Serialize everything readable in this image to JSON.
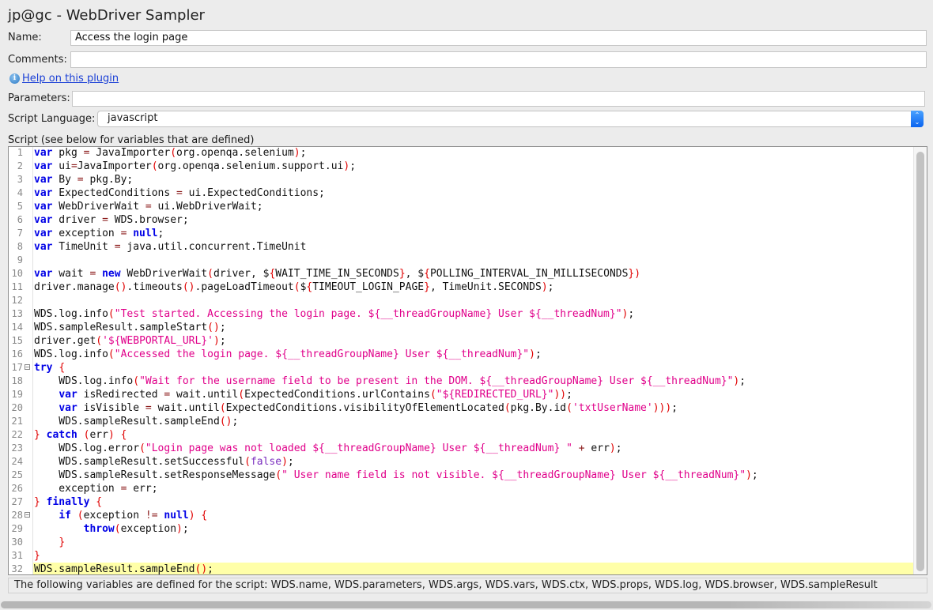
{
  "window": {
    "title": "jp@gc - WebDriver Sampler"
  },
  "form": {
    "name_label": "Name:",
    "name_value": "Access the login page",
    "comments_label": "Comments:",
    "comments_value": "",
    "help_link": "Help on this plugin",
    "parameters_label": "Parameters:",
    "parameters_value": "",
    "script_language_label": "Script Language:",
    "script_language_value": "javascript",
    "script_label": "Script (see below for variables that are defined)"
  },
  "editor": {
    "highlighted_line": 32,
    "fold_markers": [
      17,
      28
    ],
    "lines": [
      [
        [
          "kw",
          "var"
        ],
        [
          "id",
          " pkg "
        ],
        [
          "op",
          "="
        ],
        [
          "id",
          " JavaImporter"
        ],
        [
          "br",
          "("
        ],
        [
          "id",
          "org.openqa.selenium"
        ],
        [
          "br",
          ")"
        ],
        [
          "id",
          ";"
        ]
      ],
      [
        [
          "kw",
          "var"
        ],
        [
          "id",
          " ui"
        ],
        [
          "op",
          "="
        ],
        [
          "id",
          "JavaImporter"
        ],
        [
          "br",
          "("
        ],
        [
          "id",
          "org.openqa.selenium.support.ui"
        ],
        [
          "br",
          ")"
        ],
        [
          "id",
          ";"
        ]
      ],
      [
        [
          "kw",
          "var"
        ],
        [
          "id",
          " By "
        ],
        [
          "op",
          "="
        ],
        [
          "id",
          " pkg.By;"
        ]
      ],
      [
        [
          "kw",
          "var"
        ],
        [
          "id",
          " ExpectedConditions "
        ],
        [
          "op",
          "="
        ],
        [
          "id",
          " ui.ExpectedConditions;"
        ]
      ],
      [
        [
          "kw",
          "var"
        ],
        [
          "id",
          " WebDriverWait "
        ],
        [
          "op",
          "="
        ],
        [
          "id",
          " ui.WebDriverWait;"
        ]
      ],
      [
        [
          "kw",
          "var"
        ],
        [
          "id",
          " driver "
        ],
        [
          "op",
          "="
        ],
        [
          "id",
          " WDS.browser;"
        ]
      ],
      [
        [
          "kw",
          "var"
        ],
        [
          "id",
          " exception "
        ],
        [
          "op",
          "="
        ],
        [
          "id",
          " "
        ],
        [
          "kw",
          "null"
        ],
        [
          "id",
          ";"
        ]
      ],
      [
        [
          "kw",
          "var"
        ],
        [
          "id",
          " TimeUnit "
        ],
        [
          "op",
          "="
        ],
        [
          "id",
          " java.util.concurrent.TimeUnit"
        ]
      ],
      [],
      [
        [
          "kw",
          "var"
        ],
        [
          "id",
          " wait "
        ],
        [
          "op",
          "="
        ],
        [
          "id",
          " "
        ],
        [
          "kw",
          "new"
        ],
        [
          "id",
          " WebDriverWait"
        ],
        [
          "br",
          "("
        ],
        [
          "id",
          "driver, $"
        ],
        [
          "br",
          "{"
        ],
        [
          "id",
          "WAIT_TIME_IN_SECONDS"
        ],
        [
          "br",
          "}"
        ],
        [
          "id",
          ", $"
        ],
        [
          "br",
          "{"
        ],
        [
          "id",
          "POLLING_INTERVAL_IN_MILLISECONDS"
        ],
        [
          "br",
          "})"
        ]
      ],
      [
        [
          "id",
          "driver.manage"
        ],
        [
          "br",
          "()"
        ],
        [
          "id",
          ".timeouts"
        ],
        [
          "br",
          "()"
        ],
        [
          "id",
          ".pageLoadTimeout"
        ],
        [
          "br",
          "("
        ],
        [
          "id",
          "$"
        ],
        [
          "br",
          "{"
        ],
        [
          "id",
          "TIMEOUT_LOGIN_PAGE"
        ],
        [
          "br",
          "}"
        ],
        [
          "id",
          ", TimeUnit.SECONDS"
        ],
        [
          "br",
          ")"
        ],
        [
          "id",
          ";"
        ]
      ],
      [],
      [
        [
          "id",
          "WDS.log.info"
        ],
        [
          "br",
          "("
        ],
        [
          "str",
          "\"Test started. Accessing the login page. ${__threadGroupName} User ${__threadNum}\""
        ],
        [
          "br",
          ")"
        ],
        [
          "id",
          ";"
        ]
      ],
      [
        [
          "id",
          "WDS.sampleResult.sampleStart"
        ],
        [
          "br",
          "()"
        ],
        [
          "id",
          ";"
        ]
      ],
      [
        [
          "id",
          "driver.get"
        ],
        [
          "br",
          "("
        ],
        [
          "str",
          "'${WEBPORTAL_URL}'"
        ],
        [
          "br",
          ")"
        ],
        [
          "id",
          ";"
        ]
      ],
      [
        [
          "id",
          "WDS.log.info"
        ],
        [
          "br",
          "("
        ],
        [
          "str",
          "\"Accessed the login page. ${__threadGroupName} User ${__threadNum}\""
        ],
        [
          "br",
          ")"
        ],
        [
          "id",
          ";"
        ]
      ],
      [
        [
          "kw",
          "try"
        ],
        [
          "id",
          " "
        ],
        [
          "br",
          "{"
        ]
      ],
      [
        [
          "id",
          "    WDS.log.info"
        ],
        [
          "br",
          "("
        ],
        [
          "str",
          "\"Wait for the username field to be present in the DOM. ${__threadGroupName} User ${__threadNum}\""
        ],
        [
          "br",
          ")"
        ],
        [
          "id",
          ";"
        ]
      ],
      [
        [
          "id",
          "    "
        ],
        [
          "kw",
          "var"
        ],
        [
          "id",
          " isRedirected "
        ],
        [
          "op",
          "="
        ],
        [
          "id",
          " wait.until"
        ],
        [
          "br",
          "("
        ],
        [
          "id",
          "ExpectedConditions.urlContains"
        ],
        [
          "br",
          "("
        ],
        [
          "str",
          "\"${REDIRECTED_URL}\""
        ],
        [
          "br",
          "))"
        ],
        [
          "id",
          ";"
        ]
      ],
      [
        [
          "id",
          "    "
        ],
        [
          "kw",
          "var"
        ],
        [
          "id",
          " isVisible "
        ],
        [
          "op",
          "="
        ],
        [
          "id",
          " wait.until"
        ],
        [
          "br",
          "("
        ],
        [
          "id",
          "ExpectedConditions.visibilityOfElementLocated"
        ],
        [
          "br",
          "("
        ],
        [
          "id",
          "pkg.By.id"
        ],
        [
          "br",
          "("
        ],
        [
          "str",
          "'txtUserName'"
        ],
        [
          "br",
          ")))"
        ],
        [
          "id",
          ";"
        ]
      ],
      [
        [
          "id",
          "    WDS.sampleResult.sampleEnd"
        ],
        [
          "br",
          "()"
        ],
        [
          "id",
          ";"
        ]
      ],
      [
        [
          "br",
          "}"
        ],
        [
          "id",
          " "
        ],
        [
          "kw",
          "catch"
        ],
        [
          "id",
          " "
        ],
        [
          "br",
          "("
        ],
        [
          "id",
          "err"
        ],
        [
          "br",
          ")"
        ],
        [
          "id",
          " "
        ],
        [
          "br",
          "{"
        ]
      ],
      [
        [
          "id",
          "    WDS.log.error"
        ],
        [
          "br",
          "("
        ],
        [
          "str",
          "\"Login page was not loaded ${__threadGroupName} User ${__threadNum} \""
        ],
        [
          "id",
          " "
        ],
        [
          "op",
          "+"
        ],
        [
          "id",
          " err"
        ],
        [
          "br",
          ")"
        ],
        [
          "id",
          ";"
        ]
      ],
      [
        [
          "id",
          "    WDS.sampleResult.setSuccessful"
        ],
        [
          "br",
          "("
        ],
        [
          "lit",
          "false"
        ],
        [
          "br",
          ")"
        ],
        [
          "id",
          ";"
        ]
      ],
      [
        [
          "id",
          "    WDS.sampleResult.setResponseMessage"
        ],
        [
          "br",
          "("
        ],
        [
          "str",
          "\" User name field is not visible. ${__threadGroupName} User ${__threadNum}\""
        ],
        [
          "br",
          ")"
        ],
        [
          "id",
          ";"
        ]
      ],
      [
        [
          "id",
          "    exception "
        ],
        [
          "op",
          "="
        ],
        [
          "id",
          " err;"
        ]
      ],
      [
        [
          "br",
          "}"
        ],
        [
          "id",
          " "
        ],
        [
          "kw",
          "finally"
        ],
        [
          "id",
          " "
        ],
        [
          "br",
          "{"
        ]
      ],
      [
        [
          "id",
          "    "
        ],
        [
          "kw",
          "if"
        ],
        [
          "id",
          " "
        ],
        [
          "br",
          "("
        ],
        [
          "id",
          "exception "
        ],
        [
          "op",
          "!="
        ],
        [
          "id",
          " "
        ],
        [
          "kw",
          "null"
        ],
        [
          "br",
          ")"
        ],
        [
          "id",
          " "
        ],
        [
          "br",
          "{"
        ]
      ],
      [
        [
          "id",
          "        "
        ],
        [
          "kw",
          "throw"
        ],
        [
          "br",
          "("
        ],
        [
          "id",
          "exception"
        ],
        [
          "br",
          ")"
        ],
        [
          "id",
          ";"
        ]
      ],
      [
        [
          "id",
          "    "
        ],
        [
          "br",
          "}"
        ]
      ],
      [
        [
          "br",
          "}"
        ]
      ],
      [
        [
          "id",
          "WDS.sampleResult.sampleEnd"
        ],
        [
          "br",
          "()"
        ],
        [
          "id",
          ";"
        ]
      ]
    ]
  },
  "footer": {
    "variables_text": "The following variables are defined for the script: WDS.name, WDS.parameters, WDS.args, WDS.vars, WDS.ctx, WDS.props, WDS.log, WDS.browser, WDS.sampleResult"
  },
  "icons": {
    "info": "info-icon",
    "select_arrows": "up-down-chevron-icon",
    "fold": "collapse-icon"
  }
}
